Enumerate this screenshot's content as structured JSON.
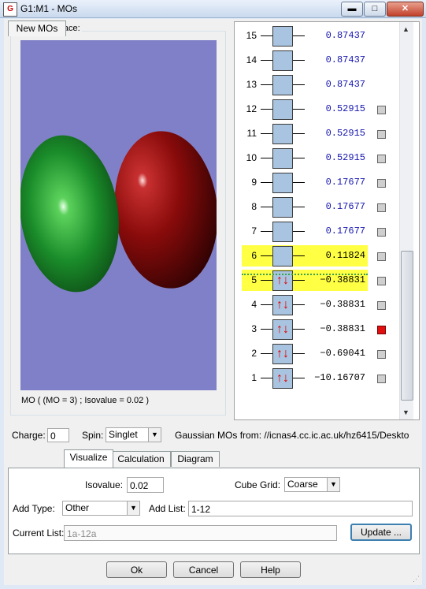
{
  "window": {
    "title": "G1:M1 - MOs",
    "app_icon": "gaussview-icon",
    "minimize": "▬",
    "maximize": "□",
    "close": "✕"
  },
  "surface": {
    "label": "Current Surface:",
    "caption": "MO ( (MO = 3) ; Isovalue = 0.02 )",
    "background_color": "#8080c8",
    "lobe_colors": [
      "#1a8c2a",
      "#8a0b0b"
    ]
  },
  "mo_list": [
    {
      "index": "15",
      "energy": "0.87437",
      "occupancy": 0,
      "checkbox": false,
      "highlight": false
    },
    {
      "index": "14",
      "energy": "0.87437",
      "occupancy": 0,
      "checkbox": false,
      "highlight": false
    },
    {
      "index": "13",
      "energy": "0.87437",
      "occupancy": 0,
      "checkbox": false,
      "highlight": false
    },
    {
      "index": "12",
      "energy": "0.52915",
      "occupancy": 0,
      "checkbox": true,
      "highlight": false
    },
    {
      "index": "11",
      "energy": "0.52915",
      "occupancy": 0,
      "checkbox": true,
      "highlight": false
    },
    {
      "index": "10",
      "energy": "0.52915",
      "occupancy": 0,
      "checkbox": true,
      "highlight": false
    },
    {
      "index": "9",
      "energy": "0.17677",
      "occupancy": 0,
      "checkbox": true,
      "highlight": false
    },
    {
      "index": "8",
      "energy": "0.17677",
      "occupancy": 0,
      "checkbox": true,
      "highlight": false
    },
    {
      "index": "7",
      "energy": "0.17677",
      "occupancy": 0,
      "checkbox": true,
      "highlight": false
    },
    {
      "index": "6",
      "energy": "0.11824",
      "occupancy": 0,
      "checkbox": true,
      "highlight": true
    },
    {
      "index": "5",
      "energy": "−0.38831",
      "occupancy": 2,
      "checkbox": true,
      "highlight": true
    },
    {
      "index": "4",
      "energy": "−0.38831",
      "occupancy": 2,
      "checkbox": true,
      "highlight": false
    },
    {
      "index": "3",
      "energy": "−0.38831",
      "occupancy": 2,
      "checkbox": true,
      "highlight": false,
      "selected": true
    },
    {
      "index": "2",
      "energy": "−0.69041",
      "occupancy": 2,
      "checkbox": true,
      "highlight": false
    },
    {
      "index": "1",
      "energy": "−10.16707",
      "occupancy": 2,
      "checkbox": true,
      "highlight": false
    }
  ],
  "controls": {
    "charge_label": "Charge:",
    "charge_value": "0",
    "spin_label": "Spin:",
    "spin_value": "Singlet",
    "source_text": "Gaussian MOs from:  //icnas4.cc.ic.ac.uk/hz6415/Deskto"
  },
  "tabs": [
    {
      "label": "New MOs",
      "active": false
    },
    {
      "label": "Visualize",
      "active": true
    },
    {
      "label": "Calculation",
      "active": false
    },
    {
      "label": "Diagram",
      "active": false
    }
  ],
  "visualize": {
    "isovalue_label": "Isovalue:",
    "isovalue": "0.02",
    "cube_grid_label": "Cube Grid:",
    "cube_grid": "Coarse",
    "add_type_label": "Add Type:",
    "add_type": "Other",
    "add_list_label": "Add List:",
    "add_list": "1-12",
    "current_list_label": "Current List:",
    "current_list": "1a-12a",
    "update_label": "Update ..."
  },
  "buttons": {
    "ok": "Ok",
    "cancel": "Cancel",
    "help": "Help"
  }
}
